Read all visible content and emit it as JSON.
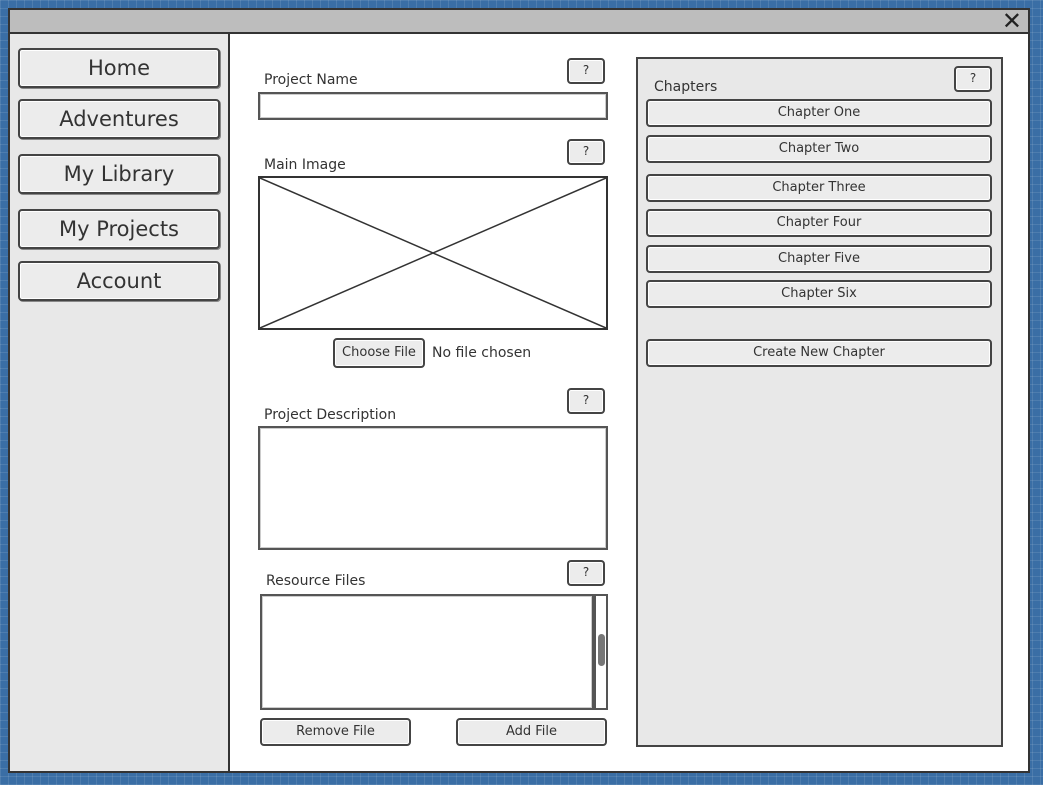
{
  "window": {
    "close_glyph": "✕"
  },
  "sidebar": {
    "items": [
      {
        "label": "Home"
      },
      {
        "label": "Adventures"
      },
      {
        "label": "My Library"
      },
      {
        "label": "My Projects"
      },
      {
        "label": "Account"
      }
    ]
  },
  "form": {
    "help_label": "?",
    "project_name": {
      "label": "Project Name",
      "value": ""
    },
    "main_image": {
      "label": "Main Image",
      "choose_file_label": "Choose File",
      "file_status": "No file chosen"
    },
    "project_description": {
      "label": "Project Description",
      "value": ""
    },
    "resource_files": {
      "label": "Resource Files",
      "remove_label": "Remove File",
      "add_label": "Add File"
    }
  },
  "chapters": {
    "label": "Chapters",
    "items": [
      {
        "label": "Chapter One"
      },
      {
        "label": "Chapter Two"
      },
      {
        "label": "Chapter Three"
      },
      {
        "label": "Chapter Four"
      },
      {
        "label": "Chapter Five"
      },
      {
        "label": "Chapter Six"
      }
    ],
    "create_label": "Create New Chapter"
  }
}
